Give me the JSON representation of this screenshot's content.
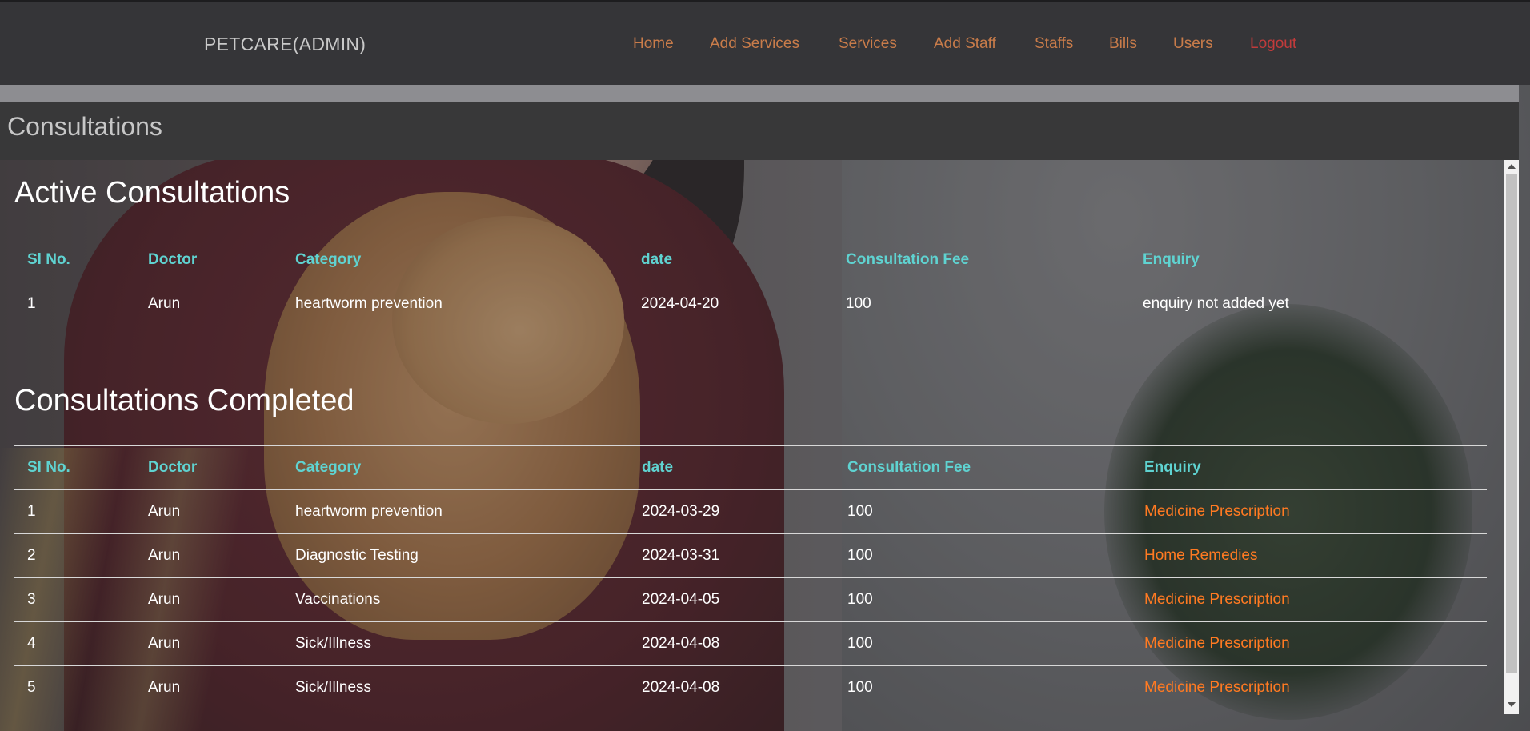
{
  "navbar": {
    "brand": "PETCARE(ADMIN)",
    "links": [
      {
        "label": "Home"
      },
      {
        "label": "Add Services"
      },
      {
        "label": "Services"
      },
      {
        "label": "Add Staff"
      },
      {
        "label": "Staffs"
      },
      {
        "label": "Bills"
      },
      {
        "label": "Users"
      },
      {
        "label": "Logout"
      }
    ]
  },
  "page": {
    "title": "Consultations"
  },
  "active": {
    "heading": "Active Consultations",
    "columns": [
      "Sl No.",
      "Doctor",
      "Category",
      "date",
      "Consultation Fee",
      "Enquiry"
    ],
    "rows": [
      {
        "sl": "1",
        "doctor": "Arun",
        "category": "heartworm prevention",
        "date": "2024-04-20",
        "fee": "100",
        "enquiry": "enquiry not added yet"
      }
    ]
  },
  "completed": {
    "heading": "Consultations Completed",
    "columns": [
      "Sl No.",
      "Doctor",
      "Category",
      "date",
      "Consultation Fee",
      "Enquiry"
    ],
    "rows": [
      {
        "sl": "1",
        "doctor": "Arun",
        "category": "heartworm prevention",
        "date": "2024-03-29",
        "fee": "100",
        "enquiry": "Medicine Prescription"
      },
      {
        "sl": "2",
        "doctor": "Arun",
        "category": "Diagnostic Testing",
        "date": "2024-03-31",
        "fee": "100",
        "enquiry": "Home Remedies"
      },
      {
        "sl": "3",
        "doctor": "Arun",
        "category": "Vaccinations",
        "date": "2024-04-05",
        "fee": "100",
        "enquiry": "Medicine Prescription"
      },
      {
        "sl": "4",
        "doctor": "Arun",
        "category": "Sick/Illness",
        "date": "2024-04-08",
        "fee": "100",
        "enquiry": "Medicine Prescription"
      },
      {
        "sl": "5",
        "doctor": "Arun",
        "category": "Sick/Illness",
        "date": "2024-04-08",
        "fee": "100",
        "enquiry": "Medicine Prescription"
      }
    ]
  },
  "colors": {
    "header_text": "#5fd3d1",
    "link_text": "#ff7a22",
    "nav_link": "#c97c4a",
    "logout": "#c23b3b",
    "navbar_bg": "#353538"
  }
}
